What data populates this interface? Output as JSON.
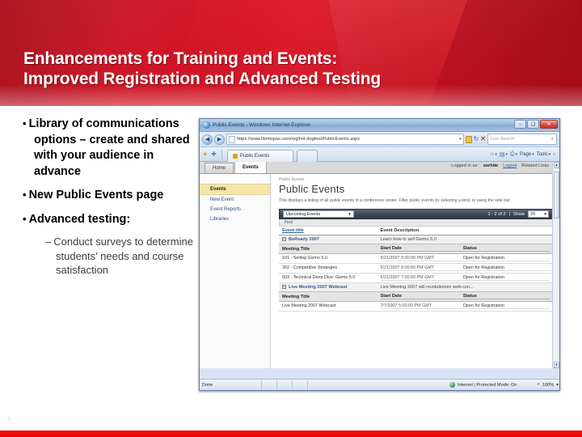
{
  "slide": {
    "title_line1": "Enhancements for Training and Events:",
    "title_line2": "Improved Registration and Advanced Testing",
    "number": "9",
    "accent_color": "#cf1423",
    "footer_color": "#ef0a0a"
  },
  "bullets": [
    {
      "marker": "•",
      "text": "Library of communications options – create and shared with your audience in advance"
    },
    {
      "marker": "•",
      "text": "New Public Events page"
    },
    {
      "marker": "•",
      "text": "Advanced testing:"
    }
  ],
  "sub_bullets": [
    {
      "marker": "–",
      "text": "Conduct surveys to determine students’ needs and course satisfaction"
    }
  ],
  "browser": {
    "window_title": "Public Events - Windows Internet Explorer",
    "minimize_label": "–",
    "maximize_label": "❑",
    "close_label": "✕",
    "back_label": "◀",
    "forward_label": "▶",
    "address_value": "https://www.libmtspas.com/reg/lmt-dogtool/PublicEvents.aspx",
    "address_dropdown": "▾",
    "refresh_label": "↻",
    "stop_label": "✕",
    "search_placeholder": "Live Search",
    "search_icon": "⌕",
    "tab_label": "Public Events",
    "blank_tab_label": "",
    "toolbar": {
      "home": "⌂",
      "feeds": "▤",
      "print": "⎙",
      "page_label": "Page",
      "tools_label": "Tools",
      "overflow": "»",
      "caret": "▾"
    },
    "status": {
      "left": "Done",
      "zone": "Internet | Protected Mode: On",
      "zoom": "100%",
      "zoom_caret": "▾"
    },
    "scroll": {
      "up": "▴",
      "down": "▾"
    }
  },
  "site": {
    "tabs": [
      {
        "label": "Home",
        "active": false
      },
      {
        "label": "Events",
        "active": true
      }
    ],
    "login_prefix": "Logged in as:",
    "login_user": "serhite",
    "logout_label": "Logout",
    "related_links_label": "Related Links",
    "related_links_caret": "▾",
    "nav_items": [
      {
        "label": "Events",
        "selected": true
      },
      {
        "label": "New Event",
        "selected": false
      },
      {
        "label": "Event Reports",
        "selected": false
      },
      {
        "label": "Libraries",
        "selected": false
      }
    ],
    "breadcrumb": "Public Events",
    "page_title": "Public Events",
    "page_description": "This displays a listing of all public events in a conference center. Filter public events by selecting a kind, or using the side bar.",
    "filter": {
      "selected": "Upcoming Events",
      "caret": "▾",
      "count_text": "1 - 2 of 2",
      "separator": "|",
      "show_label": "Show",
      "show_value": "20"
    },
    "find_label": "Find",
    "table": {
      "headers": [
        "Event title",
        "Event Description"
      ],
      "sub_headers": [
        "Meeting Title",
        "Start Date",
        "Status"
      ],
      "groups": [
        {
          "expander": "−",
          "name": "BeReady 2007",
          "description": "Learn how to sell Gizmo 5.0",
          "rows": [
            {
              "title": "101 - Selling Gizmo 5.0",
              "start": "5/21/2007 5:00:00 PM GMT",
              "status": "Open for Registration"
            },
            {
              "title": "302 - Competitive Strategies",
              "start": "5/21/2007 6:00:00 PM GMT",
              "status": "Open for Registration"
            },
            {
              "title": "503 - Technical Deep Dive: Gizmo 5.0",
              "start": "5/21/2007 7:00:00 PM GMT",
              "status": "Open for Registration"
            }
          ]
        },
        {
          "expander": "−",
          "name": "Live Meeting 2007 Webcast",
          "description": "Live Meeting 2007 will revolutionize web-con...",
          "rows": [
            {
              "title": "Live Meeting 2007 Webcast",
              "start": "7/7/2007 5:00:00 PM GMT",
              "status": "Open for Registration"
            }
          ]
        }
      ]
    }
  }
}
